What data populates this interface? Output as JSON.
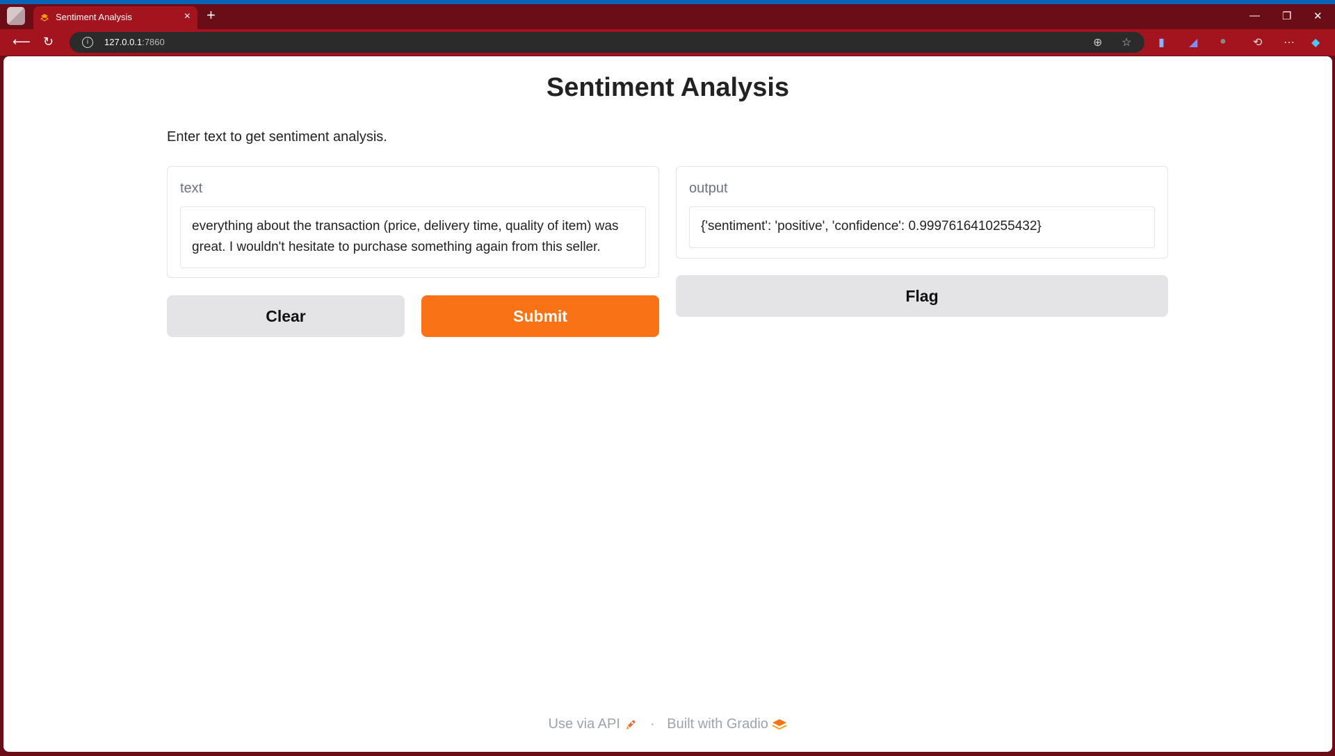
{
  "browser": {
    "tab_title": "Sentiment Analysis",
    "tab_close": "×",
    "new_tab": "+",
    "url_host": "127.0.0.1",
    "url_port": ":7860",
    "window_controls": {
      "minimize": "—",
      "restore": "❐",
      "close": "✕"
    }
  },
  "app": {
    "title": "Sentiment Analysis",
    "description": "Enter text to get sentiment analysis."
  },
  "input": {
    "label": "text",
    "value": "everything about the transaction (price, delivery time, quality of item) was great.  I wouldn't hesitate to purchase something again from this seller."
  },
  "output": {
    "label": "output",
    "value": "{'sentiment': 'positive', 'confidence': 0.9997616410255432}"
  },
  "buttons": {
    "clear": "Clear",
    "submit": "Submit",
    "flag": "Flag"
  },
  "footer": {
    "api": "Use via API",
    "separator": "·",
    "built_with": "Built with Gradio"
  },
  "colors": {
    "accent": "#f97316",
    "browser_frame": "#a3141f"
  }
}
